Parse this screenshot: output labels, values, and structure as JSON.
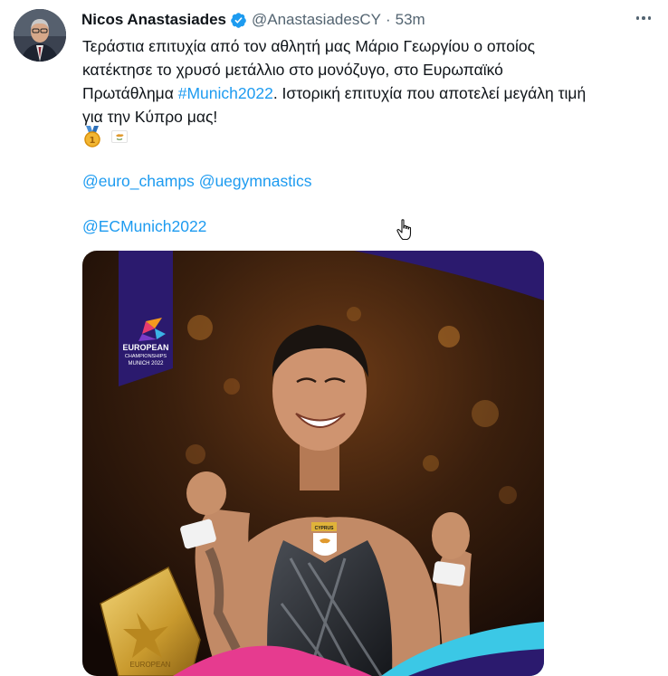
{
  "tweet": {
    "author_name": "Nicos Anastasiades",
    "handle": "@AnastasiadesCY",
    "separator": "·",
    "time": "53m",
    "text_line1": "Τεράστια επιτυχία από τον αθλητή μας Μάριο Γεωργίου ο οποίος",
    "text_line2": "κατέκτησε το χρυσό μετάλλιο στο μονόζυγο, στο Ευρωπαϊκό",
    "text_line3_pre": "Πρωτάθλημα ",
    "hashtag": "#Munich2022",
    "text_line3_post": ". Ιστορική επιτυχία που αποτελεί μεγάλη τιμή",
    "text_line4": "για την Κύπρο μας!",
    "emojis": [
      "gold-medal",
      "cyprus-flag"
    ],
    "mention1": "@euro_champs",
    "mention2": "@uegymnastics",
    "mention3": "@ECMunich2022"
  },
  "media": {
    "logo_line1": "EUROPEAN",
    "logo_line2": "CHAMPIONSHIPS",
    "logo_line3": "MUNICH 2022",
    "jersey_text": "CYPRUS",
    "trophy_text": "EUROPEAN"
  },
  "colors": {
    "link": "#1d9bf0",
    "secondary_text": "#536471",
    "banner_purple": "#2b1a6e",
    "trophy_gold": "#d9b54a"
  }
}
